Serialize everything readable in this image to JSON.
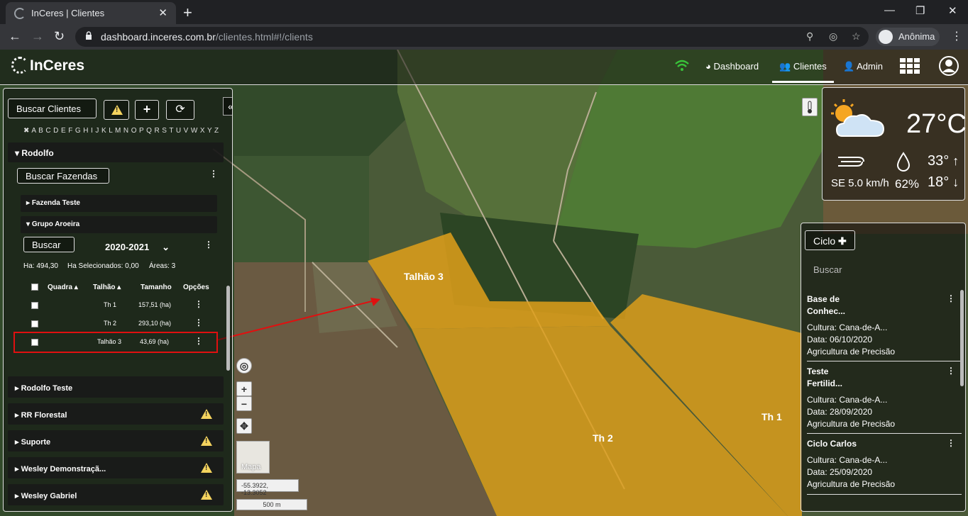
{
  "browser": {
    "tab_title": "InCeres | Clientes",
    "url_host": "dashboard.inceres.com.br",
    "url_path": "/clientes.html#!/clients",
    "profile": "Anônima"
  },
  "header": {
    "logo": "InCeres",
    "nav": {
      "dashboard": "Dashboard",
      "clientes": "Clientes",
      "admin": "Admin"
    }
  },
  "left_panel": {
    "search_clients": "Buscar Clientes",
    "alphabet": "✖ A B C D E F G H I J K L M N O P Q R S T U V W X Y Z",
    "client_open": "Rodolfo",
    "search_farms": "Buscar Fazendas",
    "farm_1": "Fazenda Teste",
    "farm_2": "Grupo Aroeira",
    "search_btn": "Buscar",
    "season": "2020-2021",
    "stats": {
      "ha": "Ha: 494,30",
      "selected": "Ha Selecionados: 0,00",
      "areas": "Áreas: 3"
    },
    "table": {
      "headers": [
        "Quadra",
        "Talhão",
        "Tamanho",
        "Opções"
      ],
      "rows": [
        {
          "talhao": "Th 1",
          "tamanho": "157,51 (ha)"
        },
        {
          "talhao": "Th 2",
          "tamanho": "293,10 (ha)"
        },
        {
          "talhao": "Talhão 3",
          "tamanho": "43,69 (ha)"
        }
      ]
    },
    "clients": [
      "Rodolfo Teste",
      "RR Florestal",
      "Suporte",
      "Wesley Demonstraçã...",
      "Wesley Gabriel"
    ]
  },
  "map": {
    "labels": {
      "talhao3": "Talhão 3",
      "th2": "Th 2",
      "th1": "Th 1"
    },
    "layer_button": "Mapa",
    "coords": "-55.3922, -13.3052",
    "scale": "500 m",
    "colors": {
      "field": "#e0a01a",
      "highlight_box": "#e01010",
      "arrow": "#e01010"
    }
  },
  "weather": {
    "temp": "27°C",
    "wind": "SE 5.0 km/h",
    "humidity": "62%",
    "max": "33°",
    "min": "18°"
  },
  "cycles": {
    "add_label": "Ciclo",
    "search_placeholder": "Buscar",
    "items": [
      {
        "title1": "Base de",
        "title2": "Conhec...",
        "cultura": "Cultura: Cana-de-A...",
        "data": "Data: 06/10/2020",
        "tipo": "Agricultura de Precisão"
      },
      {
        "title1": "Teste",
        "title2": "Fertilid...",
        "cultura": "Cultura: Cana-de-A...",
        "data": "Data: 28/09/2020",
        "tipo": "Agricultura de Precisão"
      },
      {
        "title1": "Ciclo Carlos",
        "title2": "",
        "cultura": "Cultura: Cana-de-A...",
        "data": "Data: 25/09/2020",
        "tipo": "Agricultura de Precisão"
      }
    ]
  }
}
